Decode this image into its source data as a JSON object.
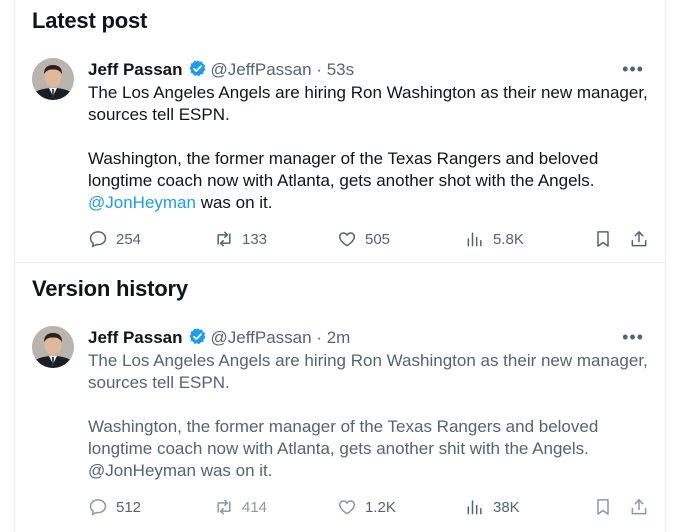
{
  "latest": {
    "section_title": "Latest post",
    "tweet": {
      "name": "Jeff Passan",
      "handle": "@JeffPassan",
      "separator": "·",
      "time": "53s",
      "text_line1": "The Los Angeles Angels are hiring Ron Washington as their new manager, sources tell ESPN.",
      "text_line2_pre": "Washington, the former manager of the Texas Rangers and beloved longtime coach now with Atlanta, gets another shot with the Angels.",
      "mention": "@JonHeyman",
      "text_line2_post": " was on it.",
      "replies": "254",
      "reposts": "133",
      "likes": "505",
      "views": "5.8K"
    }
  },
  "history": {
    "section_title": "Version history",
    "tweet": {
      "name": "Jeff Passan",
      "handle": "@JeffPassan",
      "separator": "·",
      "time": "2m",
      "text_line1": "The Los Angeles Angels are hiring Ron Washington as their new manager, sources tell ESPN.",
      "text_line2_pre": "Washington, the former manager of the Texas Rangers and beloved longtime coach now with Atlanta, gets another shit with the Angels.",
      "mention": "@JonHeyman",
      "text_line2_post": " was on it.",
      "replies": "512",
      "reposts": "414",
      "likes": "1.2K",
      "views": "38K"
    }
  },
  "icons": {
    "verified": "verified-badge-icon",
    "more": "more-icon",
    "reply": "reply-icon",
    "repost": "repost-icon",
    "like": "like-icon",
    "views": "views-icon",
    "bookmark": "bookmark-icon",
    "share": "share-icon"
  },
  "colors": {
    "accent": "#1d9bf0",
    "secondary_text": "#536471",
    "primary_text": "#0f1419",
    "divider": "#e6ecf0"
  }
}
